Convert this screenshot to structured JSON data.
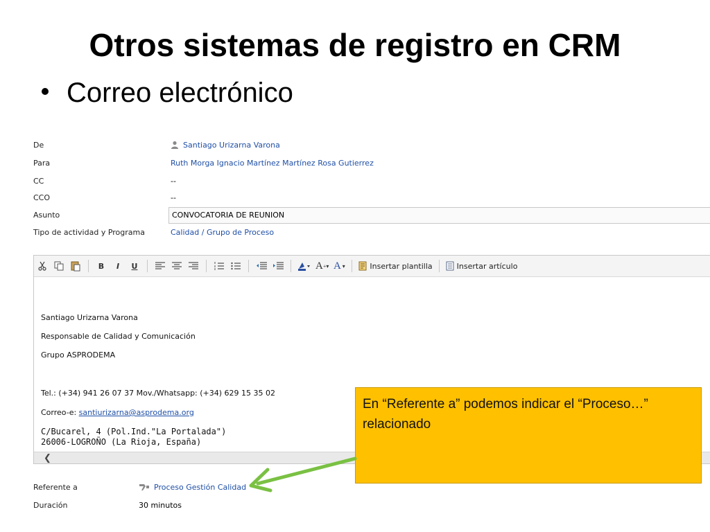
{
  "slide": {
    "title": "Otros sistemas de registro en CRM",
    "bullet": "Correo electrónico"
  },
  "form": {
    "fields": [
      {
        "label": "De",
        "value": "Santiago Urizarna Varona"
      },
      {
        "label": "Para",
        "value": "Ruth Morga Ignacio Martínez Martínez Rosa Gutierrez"
      },
      {
        "label": "CC",
        "value": "--"
      },
      {
        "label": "CCO",
        "value": "--"
      },
      {
        "label": "Asunto",
        "value": "CONVOCATORIA DE REUNION"
      },
      {
        "label": "Tipo de actividad y Programa",
        "value": "Calidad / Grupo de Proceso"
      }
    ],
    "regarding_label": "Referente a",
    "regarding_value": "Proceso Gestión Calidad",
    "duration_label": "Duración",
    "duration_value": "30 minutos"
  },
  "toolbar": {
    "bold": "B",
    "italic": "I",
    "underline": "U",
    "insert_template": "Insertar plantilla",
    "insert_article": "Insertar artículo",
    "font_color": "A",
    "font_size": "A"
  },
  "email_body": {
    "lines": [
      "Santiago Urizarna Varona",
      "Responsable de Calidad y Comunicación",
      "Grupo ASPRODEMA",
      "Tel.: (+34) 941 26 07 37 Mov./Whatsapp: (+34) 629 15 35 02"
    ],
    "email_prefix": "Correo-e: ",
    "email_link": "santiurizarna@asprodema.org",
    "address_1": "C/Bucarel, 4 (Pol.Ind.\"La Portalada\")",
    "address_2": "26006-LOGROÑO (La Rioja, España)"
  },
  "callout": {
    "text": "En “Referente a” podemos indicar el “Proceso…” relacionado"
  },
  "colors": {
    "link": "#1f4fa6",
    "callout_bg": "#ffc000",
    "arrow": "#7ac143"
  },
  "icons": [
    "person-icon",
    "cut-icon",
    "copy-icon",
    "paste-icon",
    "align-left-icon",
    "align-center-icon",
    "align-right-icon",
    "numbered-list-icon",
    "bullet-list-icon",
    "outdent-icon",
    "indent-icon",
    "highlight-icon",
    "font-size-icon",
    "font-color-icon",
    "template-icon",
    "article-icon",
    "scroll-left-icon",
    "process-icon",
    "arrow-icon"
  ]
}
